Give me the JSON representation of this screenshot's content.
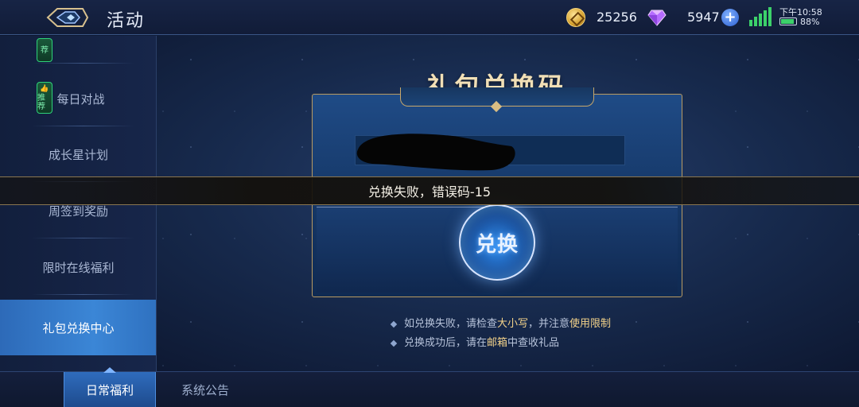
{
  "header": {
    "title": "活动",
    "coins": "25256",
    "gems": "5947",
    "plus": "+",
    "time": "下午10:58",
    "battery": "88%",
    "battery_level": 0.88
  },
  "sidebar": {
    "items": [
      {
        "label": "",
        "badge": "荐"
      },
      {
        "label": "每日对战",
        "badge": "推荐"
      },
      {
        "label": "成长星计划"
      },
      {
        "label": "周签到奖励"
      },
      {
        "label": "限时在线福利"
      },
      {
        "label": "礼包兑换中心",
        "active": true
      }
    ]
  },
  "tabs": [
    {
      "label": "日常福利",
      "active": true
    },
    {
      "label": "系统公告"
    }
  ],
  "main": {
    "title": "礼包兑换码",
    "redeem_button": "兑换",
    "toast": "兑换失败，错误码-15",
    "tips": {
      "tip1_pre": "如兑换失败，请检查",
      "tip1_hl1": "大小写",
      "tip1_mid": "，并注意",
      "tip1_hl2": "使用限制",
      "tip2_pre": "兑换成功后，请在",
      "tip2_hl": "邮箱",
      "tip2_post": "中查收礼品"
    }
  },
  "colors": {
    "accent_gold": "#f3d28a",
    "active_blue": "#3b86d6",
    "badge_green": "#2fd27a"
  }
}
